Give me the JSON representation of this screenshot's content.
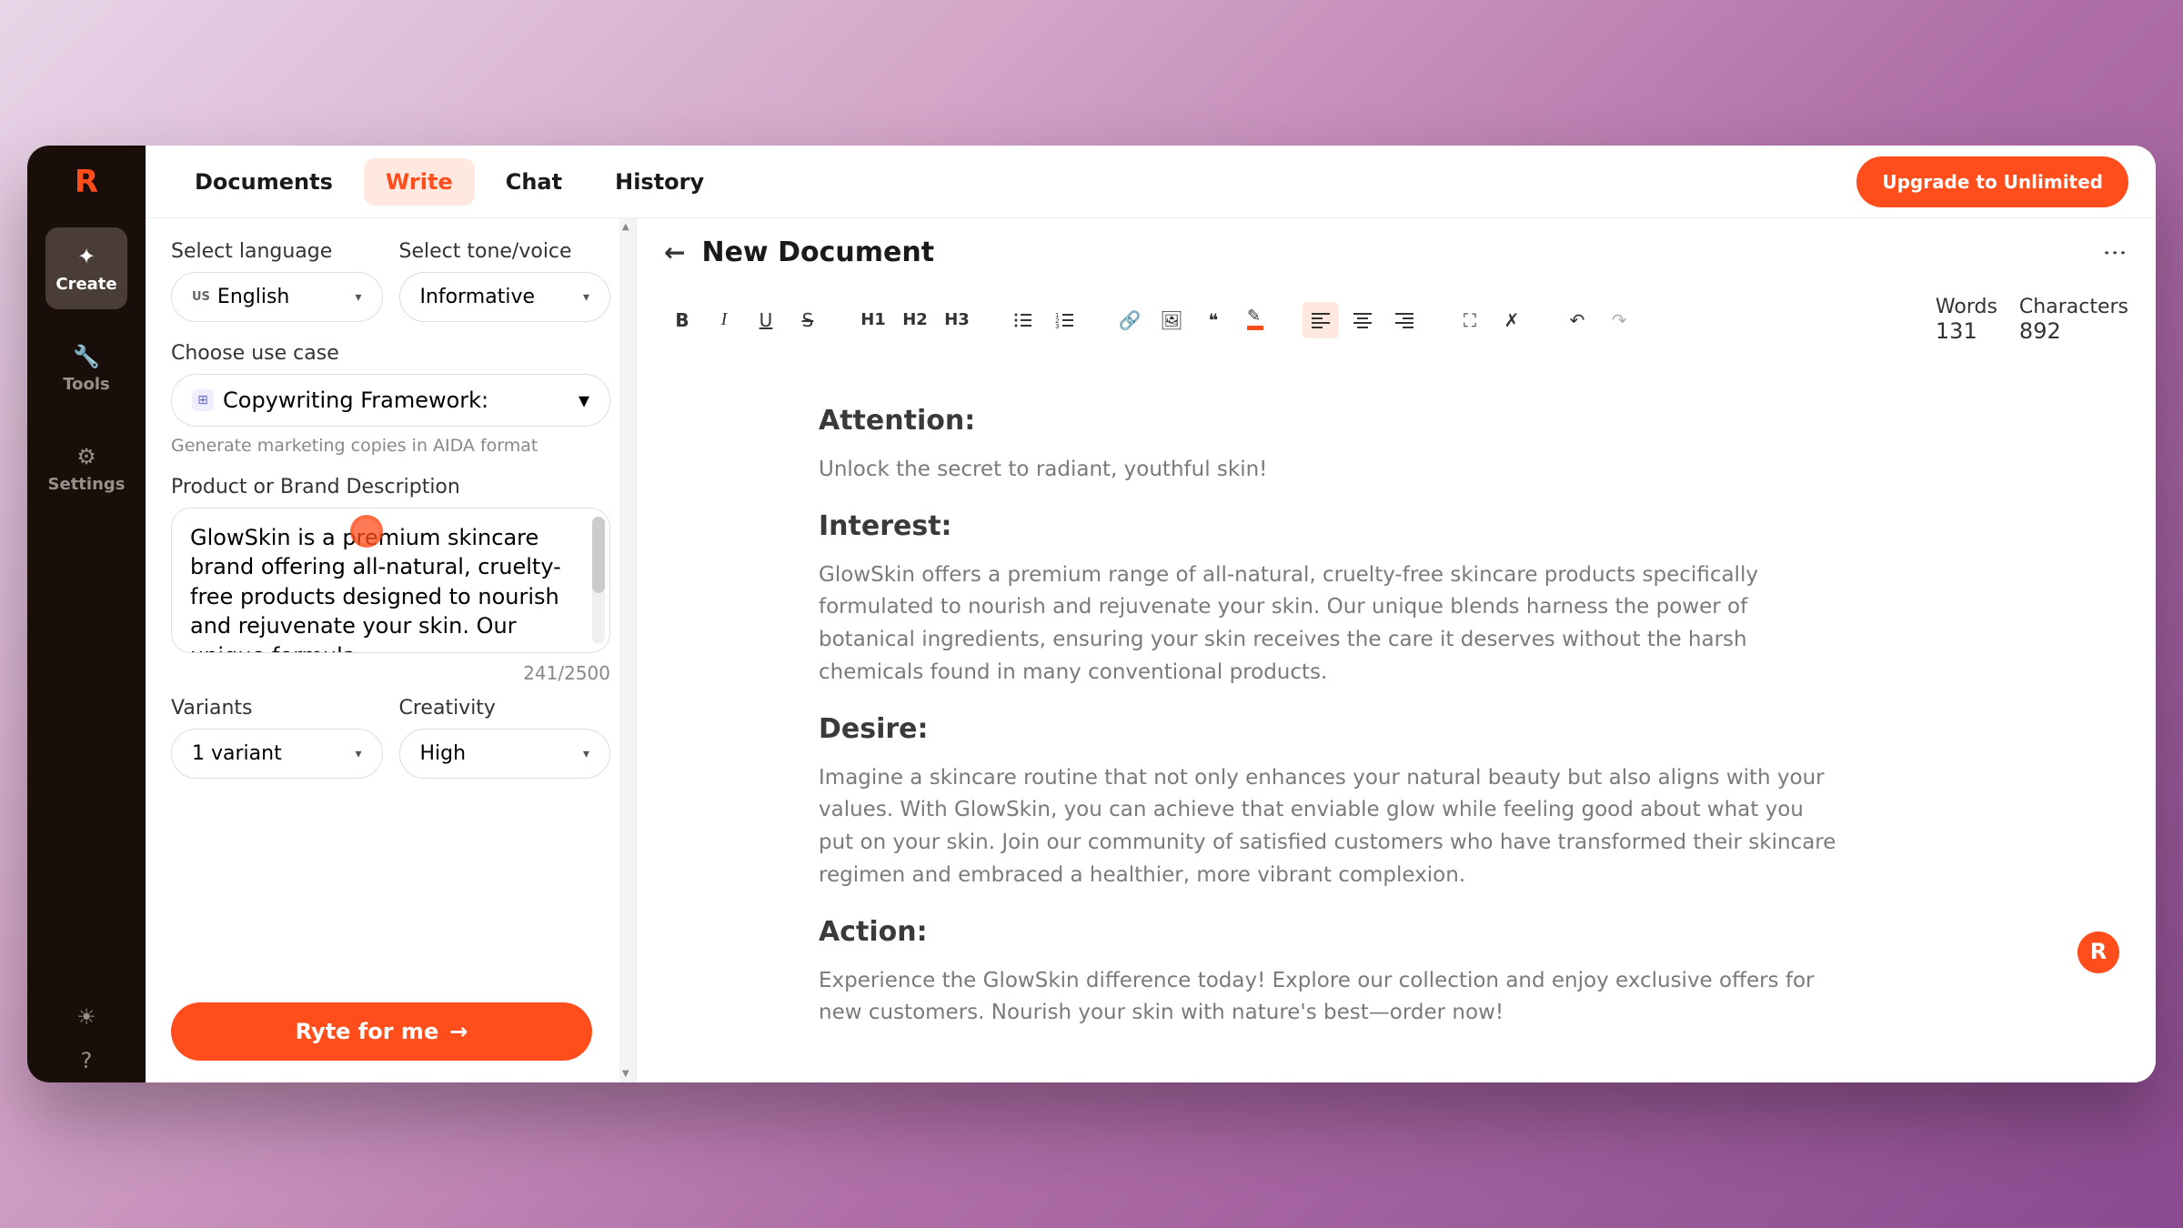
{
  "rail": {
    "items": [
      {
        "label": "Create"
      },
      {
        "label": "Tools"
      },
      {
        "label": "Settings"
      }
    ]
  },
  "tabs": {
    "items": [
      "Documents",
      "Write",
      "Chat",
      "History"
    ],
    "active": "Write"
  },
  "upgrade_label": "Upgrade to Unlimited",
  "panel": {
    "lang_label": "Select language",
    "lang_value": "English",
    "lang_flag": "US",
    "tone_label": "Select tone/voice",
    "tone_value": "Informative",
    "usecase_label": "Choose use case",
    "usecase_value": "Copywriting Framework:",
    "usecase_help": "Generate marketing copies in AIDA format",
    "desc_label": "Product or Brand Description",
    "desc_value": "GlowSkin is a premium skincare brand offering all-natural, cruelty-free products designed to nourish and rejuvenate your skin. Our unique formula…",
    "desc_counter": "241/2500",
    "variants_label": "Variants",
    "variants_value": "1 variant",
    "creativity_label": "Creativity",
    "creativity_value": "High",
    "ryte_label": "Ryte for me"
  },
  "editor": {
    "title": "New Document",
    "stats": {
      "words_label": "Words",
      "words_value": "131",
      "chars_label": "Characters",
      "chars_value": "892"
    },
    "toolbar": {
      "h1": "H1",
      "h2": "H2",
      "h3": "H3"
    },
    "content": {
      "h1": "Attention:",
      "p1": "Unlock the secret to radiant, youthful skin!",
      "h2": "Interest:",
      "p2": "GlowSkin offers a premium range of all-natural, cruelty-free skincare products specifically formulated to nourish and rejuvenate your skin. Our unique blends harness the power of botanical ingredients, ensuring your skin receives the care it deserves without the harsh chemicals found in many conventional products.",
      "h3": "Desire:",
      "p3": "Imagine a skincare routine that not only enhances your natural beauty but also aligns with your values. With GlowSkin, you can achieve that enviable glow while feeling good about what you put on your skin. Join our community of satisfied customers who have transformed their skincare regimen and embraced a healthier, more vibrant complexion.",
      "h4": "Action:",
      "p4": "Experience the GlowSkin difference today! Explore our collection and enjoy exclusive offers for new customers. Nourish your skin with nature's best—order now!"
    }
  }
}
